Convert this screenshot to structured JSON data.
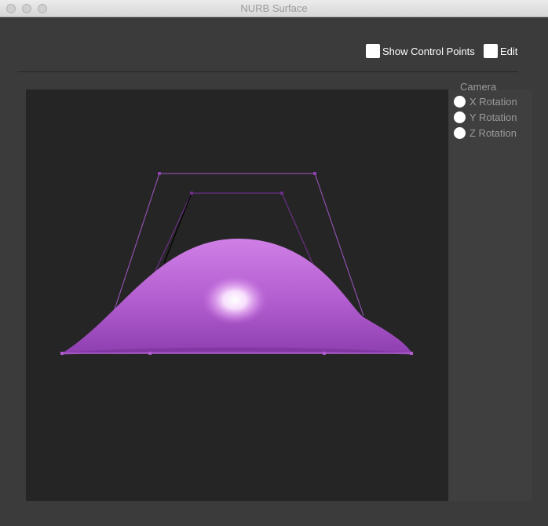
{
  "window": {
    "title": "NURB Surface"
  },
  "toolbar": {
    "show_control_points_label": "Show Control Points",
    "edit_label": "Edit"
  },
  "camera": {
    "title": "Camera",
    "options": [
      "X Rotation",
      "Y Rotation",
      "Z Rotation"
    ]
  },
  "colors": {
    "surface": "#b35ed2",
    "surface_highlight": "#ffffff",
    "control_lines": "#8e3fb0",
    "control_points": "#b05bd0",
    "canvas_bg": "#252525"
  }
}
